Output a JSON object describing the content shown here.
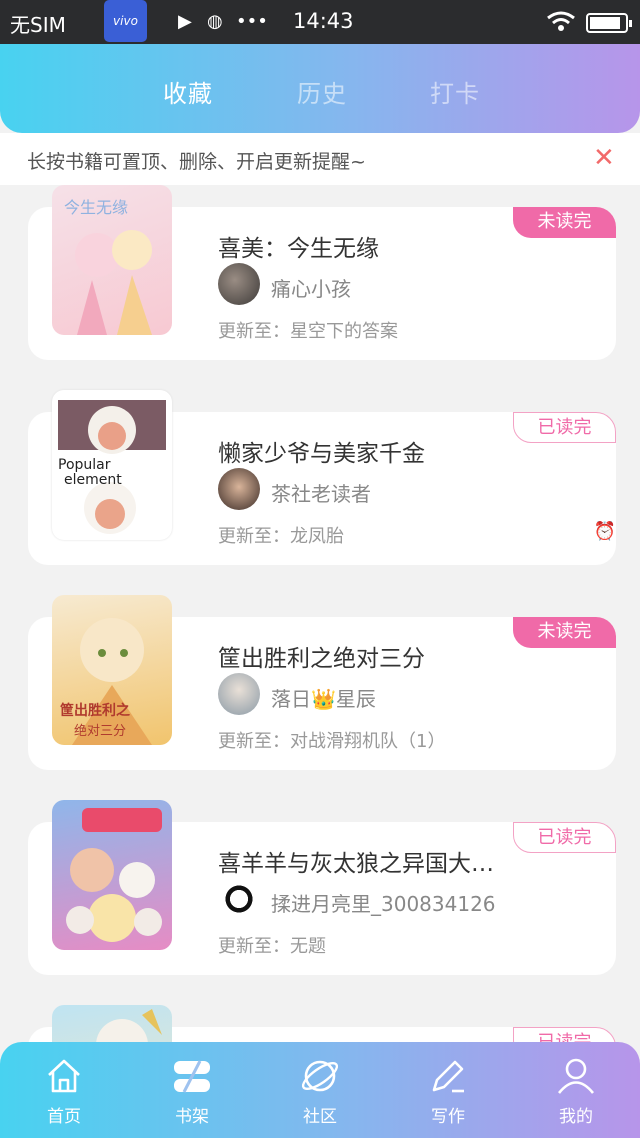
{
  "status_bar": {
    "sim": "无SIM",
    "vivo": "vivo",
    "time": "14:43"
  },
  "tabs": [
    {
      "label": "收藏",
      "active": true
    },
    {
      "label": "历史",
      "active": false
    },
    {
      "label": "打卡",
      "active": false
    }
  ],
  "tip": {
    "text": "长按书籍可置顶、删除、开启更新提醒~",
    "close_icon": "close-icon"
  },
  "books": [
    {
      "title": "喜美：今生无缘",
      "author": "痛心小孩",
      "update": "更新至：星空下的答案",
      "badge": "未读完",
      "badge_type": "unread",
      "cover_colors": [
        "#f6e1e8",
        "#f7c9d2"
      ],
      "alarm": false
    },
    {
      "title": "懒家少爷与美家千金",
      "author": "茶社老读者",
      "update": "更新至：龙凤胎",
      "badge": "已读完",
      "badge_type": "read",
      "cover_colors": [
        "#ffffff",
        "#e8d9d6"
      ],
      "cover_text": "Popular\nelement",
      "alarm": true
    },
    {
      "title": "筐出胜利之绝对三分",
      "author": "落日👑星辰",
      "update": "更新至：对战滑翔机队（1）",
      "badge": "未读完",
      "badge_type": "unread",
      "cover_colors": [
        "#f7ead1",
        "#f1c46d"
      ],
      "alarm": false
    },
    {
      "title": "喜羊羊与灰太狼之异国大…",
      "author": "揉进月亮里_300834126",
      "update": "更新至：无题",
      "badge": "已读完",
      "badge_type": "read",
      "cover_colors": [
        "#8fb6ea",
        "#e68cc4"
      ],
      "alarm": false
    },
    {
      "title": "",
      "author": "",
      "update": "",
      "badge": "已读完",
      "badge_type": "read",
      "cover_colors": [
        "#bfe4f2",
        "#f3e7c6"
      ],
      "alarm": false
    }
  ],
  "bottom_nav": [
    {
      "label": "首页",
      "icon": "home-icon"
    },
    {
      "label": "书架",
      "icon": "bookshelf-icon"
    },
    {
      "label": "社区",
      "icon": "planet-icon"
    },
    {
      "label": "写作",
      "icon": "pen-icon"
    },
    {
      "label": "我的",
      "icon": "user-icon"
    }
  ],
  "colors": {
    "gradient_start": "#48d2f0",
    "gradient_end": "#b795ea",
    "badge_pink": "#f06aa8",
    "close_red": "#f26a6a"
  }
}
